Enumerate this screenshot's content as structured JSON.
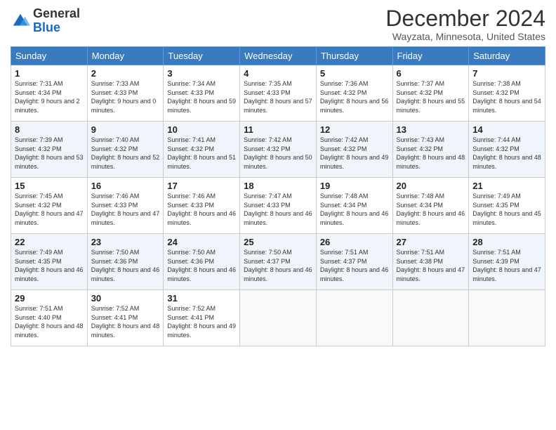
{
  "header": {
    "logo_general": "General",
    "logo_blue": "Blue",
    "month_title": "December 2024",
    "location": "Wayzata, Minnesota, United States"
  },
  "days_of_week": [
    "Sunday",
    "Monday",
    "Tuesday",
    "Wednesday",
    "Thursday",
    "Friday",
    "Saturday"
  ],
  "weeks": [
    [
      {
        "day": "1",
        "sunrise": "7:31 AM",
        "sunset": "4:34 PM",
        "daylight": "9 hours and 2 minutes."
      },
      {
        "day": "2",
        "sunrise": "7:33 AM",
        "sunset": "4:33 PM",
        "daylight": "9 hours and 0 minutes."
      },
      {
        "day": "3",
        "sunrise": "7:34 AM",
        "sunset": "4:33 PM",
        "daylight": "8 hours and 59 minutes."
      },
      {
        "day": "4",
        "sunrise": "7:35 AM",
        "sunset": "4:33 PM",
        "daylight": "8 hours and 57 minutes."
      },
      {
        "day": "5",
        "sunrise": "7:36 AM",
        "sunset": "4:32 PM",
        "daylight": "8 hours and 56 minutes."
      },
      {
        "day": "6",
        "sunrise": "7:37 AM",
        "sunset": "4:32 PM",
        "daylight": "8 hours and 55 minutes."
      },
      {
        "day": "7",
        "sunrise": "7:38 AM",
        "sunset": "4:32 PM",
        "daylight": "8 hours and 54 minutes."
      }
    ],
    [
      {
        "day": "8",
        "sunrise": "7:39 AM",
        "sunset": "4:32 PM",
        "daylight": "8 hours and 53 minutes."
      },
      {
        "day": "9",
        "sunrise": "7:40 AM",
        "sunset": "4:32 PM",
        "daylight": "8 hours and 52 minutes."
      },
      {
        "day": "10",
        "sunrise": "7:41 AM",
        "sunset": "4:32 PM",
        "daylight": "8 hours and 51 minutes."
      },
      {
        "day": "11",
        "sunrise": "7:42 AM",
        "sunset": "4:32 PM",
        "daylight": "8 hours and 50 minutes."
      },
      {
        "day": "12",
        "sunrise": "7:42 AM",
        "sunset": "4:32 PM",
        "daylight": "8 hours and 49 minutes."
      },
      {
        "day": "13",
        "sunrise": "7:43 AM",
        "sunset": "4:32 PM",
        "daylight": "8 hours and 48 minutes."
      },
      {
        "day": "14",
        "sunrise": "7:44 AM",
        "sunset": "4:32 PM",
        "daylight": "8 hours and 48 minutes."
      }
    ],
    [
      {
        "day": "15",
        "sunrise": "7:45 AM",
        "sunset": "4:32 PM",
        "daylight": "8 hours and 47 minutes."
      },
      {
        "day": "16",
        "sunrise": "7:46 AM",
        "sunset": "4:33 PM",
        "daylight": "8 hours and 47 minutes."
      },
      {
        "day": "17",
        "sunrise": "7:46 AM",
        "sunset": "4:33 PM",
        "daylight": "8 hours and 46 minutes."
      },
      {
        "day": "18",
        "sunrise": "7:47 AM",
        "sunset": "4:33 PM",
        "daylight": "8 hours and 46 minutes."
      },
      {
        "day": "19",
        "sunrise": "7:48 AM",
        "sunset": "4:34 PM",
        "daylight": "8 hours and 46 minutes."
      },
      {
        "day": "20",
        "sunrise": "7:48 AM",
        "sunset": "4:34 PM",
        "daylight": "8 hours and 46 minutes."
      },
      {
        "day": "21",
        "sunrise": "7:49 AM",
        "sunset": "4:35 PM",
        "daylight": "8 hours and 45 minutes."
      }
    ],
    [
      {
        "day": "22",
        "sunrise": "7:49 AM",
        "sunset": "4:35 PM",
        "daylight": "8 hours and 46 minutes."
      },
      {
        "day": "23",
        "sunrise": "7:50 AM",
        "sunset": "4:36 PM",
        "daylight": "8 hours and 46 minutes."
      },
      {
        "day": "24",
        "sunrise": "7:50 AM",
        "sunset": "4:36 PM",
        "daylight": "8 hours and 46 minutes."
      },
      {
        "day": "25",
        "sunrise": "7:50 AM",
        "sunset": "4:37 PM",
        "daylight": "8 hours and 46 minutes."
      },
      {
        "day": "26",
        "sunrise": "7:51 AM",
        "sunset": "4:37 PM",
        "daylight": "8 hours and 46 minutes."
      },
      {
        "day": "27",
        "sunrise": "7:51 AM",
        "sunset": "4:38 PM",
        "daylight": "8 hours and 47 minutes."
      },
      {
        "day": "28",
        "sunrise": "7:51 AM",
        "sunset": "4:39 PM",
        "daylight": "8 hours and 47 minutes."
      }
    ],
    [
      {
        "day": "29",
        "sunrise": "7:51 AM",
        "sunset": "4:40 PM",
        "daylight": "8 hours and 48 minutes."
      },
      {
        "day": "30",
        "sunrise": "7:52 AM",
        "sunset": "4:41 PM",
        "daylight": "8 hours and 48 minutes."
      },
      {
        "day": "31",
        "sunrise": "7:52 AM",
        "sunset": "4:41 PM",
        "daylight": "8 hours and 49 minutes."
      },
      null,
      null,
      null,
      null
    ]
  ]
}
